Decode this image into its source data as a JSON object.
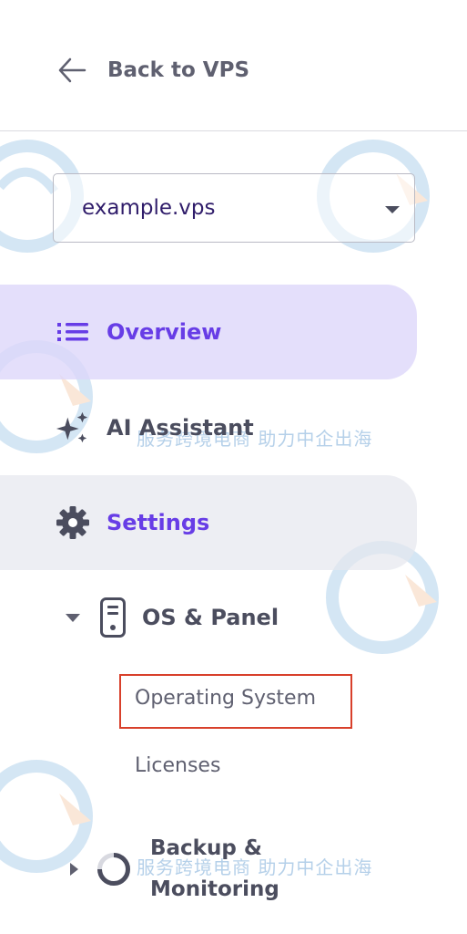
{
  "back": {
    "label": "Back to VPS"
  },
  "server_select": {
    "value": "example.vps"
  },
  "nav": {
    "overview": "Overview",
    "ai_assistant": "AI Assistant",
    "settings": "Settings",
    "os_panel": "OS & Panel",
    "operating_system": "Operating System",
    "licenses": "Licenses",
    "backup_line1": "Backup &",
    "backup_line2": "Monitoring"
  },
  "watermark": {
    "line": "服务跨境电商 助力中企出海"
  },
  "colors": {
    "accent": "#673de6",
    "text_gray": "#5f6070",
    "active_bg": "#dcd6fa",
    "highlight_border": "#d8402b"
  },
  "icons": {
    "back": "arrow-left-icon",
    "select": "chevron-down-icon",
    "overview": "list-icon",
    "ai": "sparkles-icon",
    "settings": "gear-icon",
    "os_panel": "server-icon",
    "backup": "progress-ring-icon"
  }
}
